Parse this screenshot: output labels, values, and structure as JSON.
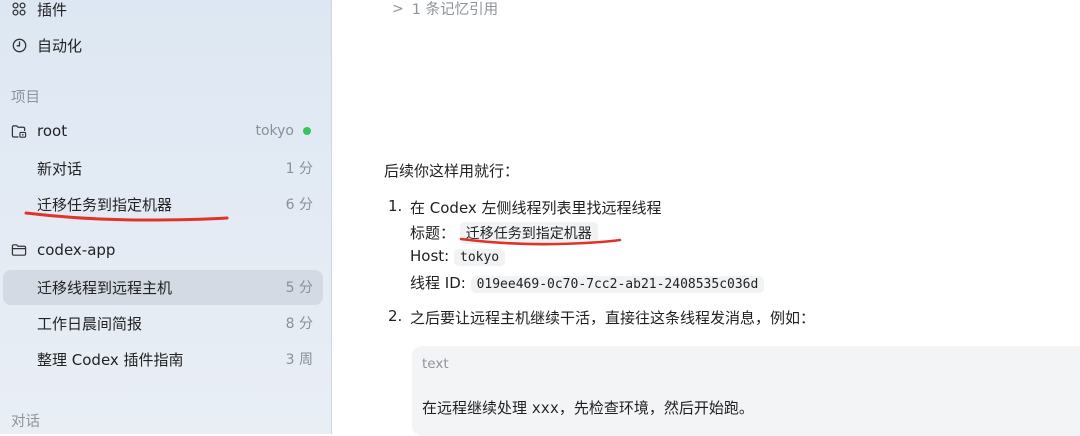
{
  "sidebar": {
    "top_items": [
      {
        "label": "插件",
        "icon": "plugins-grid-icon"
      },
      {
        "label": "自动化",
        "icon": "clock-icon"
      }
    ],
    "projects_header": "项目",
    "projects": [
      {
        "name": "root",
        "host": "tokyo",
        "status_color": "#34c759",
        "threads": [
          {
            "title": "新对话",
            "time": "1 分"
          },
          {
            "title": "迁移任务到指定机器",
            "time": "6 分"
          }
        ]
      },
      {
        "name": "codex-app",
        "threads": [
          {
            "title": "迁移线程到远程主机",
            "time": "5 分"
          },
          {
            "title": "工作日晨间简报",
            "time": "8 分"
          },
          {
            "title": "整理 Codex 插件指南",
            "time": "3 周"
          }
        ]
      }
    ],
    "chats_header": "对话"
  },
  "main": {
    "memory_ref": "1 条记忆引用",
    "intro": "后续你这样用就行：",
    "step1": {
      "number": "1.",
      "text": "在 Codex 左侧线程列表里找远程线程",
      "title_label": "标题：",
      "title_value": "迁移任务到指定机器",
      "host_label": "Host:",
      "host_value": "tokyo",
      "id_label": "线程 ID:",
      "id_value": "019ee469-0c70-7cc2-ab21-2408535c036d"
    },
    "step2": {
      "number": "2.",
      "text": "之后要让远程主机继续干活，直接往这条线程发消息，例如："
    },
    "codeblock": {
      "lang": "text",
      "prefix": "在远程继续处理 ",
      "code_token": "xxx",
      "suffix": "，先检查环境，然后开始跑。"
    }
  },
  "annotation_color": "#e0342a"
}
